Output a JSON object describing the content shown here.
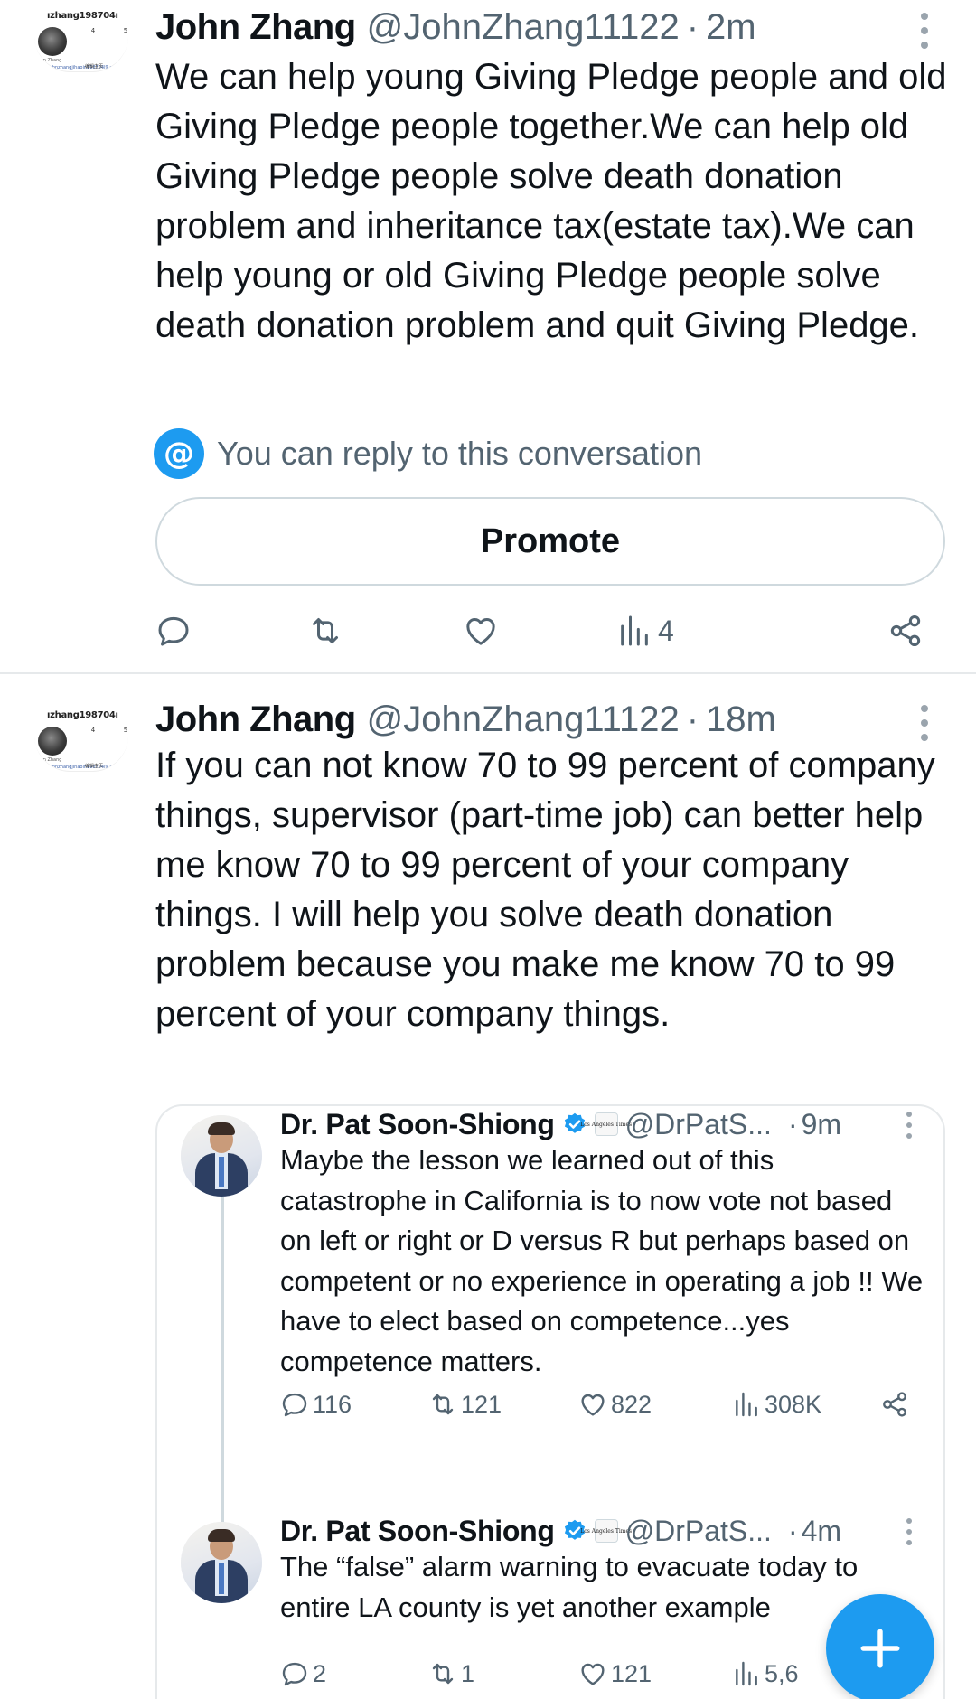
{
  "tweets": [
    {
      "avatar_card": {
        "name": "ızhang198704ı",
        "stat1": "4",
        "stat2": "5",
        "sub": "John Zhang",
        "link": "www.johnzhangjihaoin198704l9.cr",
        "button": "编辑主页"
      },
      "author_name": "John Zhang",
      "handle": "@JohnZhang11122",
      "dot": "·",
      "time": "2m",
      "text": "We can help young Giving Pledge people and old Giving Pledge people together.We can help old Giving Pledge people solve death donation problem and inheritance tax(estate tax).We can help young or old Giving Pledge people solve death donation problem and quit Giving Pledge.",
      "reply_note": "You can reply to this conversation",
      "reply_icon": "@",
      "promote_label": "Promote",
      "views": "4"
    },
    {
      "avatar_card": {
        "name": "ızhang198704ı",
        "stat1": "4",
        "stat2": "5",
        "sub": "John Zhang",
        "link": "www.johnzhangjihaoin198704l9.cr",
        "button": "编辑主页"
      },
      "author_name": "John Zhang",
      "handle": "@JohnZhang11122",
      "dot": "·",
      "time": "18m",
      "text": "If you can not know 70 to 99 percent of company things, supervisor (part-time job) can better help me know 70 to 99 percent of your company things. I will help you solve death donation problem because you make me know 70 to 99 percent of your company things."
    }
  ],
  "quoted": [
    {
      "author_name": "Dr. Pat Soon-Shiong",
      "affiliation_badge": "Los Angeles Times",
      "handle": "@DrPatS...",
      "dot": "·",
      "time": "9m",
      "text": "Maybe the lesson we learned out of this catastrophe in California is to now vote not based on left or right or D versus R but perhaps based on competent or no experience in operating a job !!  We have to elect based on competence...yes competence matters.",
      "replies": "116",
      "reposts": "121",
      "likes": "822",
      "views": "308K"
    },
    {
      "author_name": "Dr. Pat Soon-Shiong",
      "affiliation_badge": "Los Angeles Times",
      "handle": "@DrPatS...",
      "dot": "·",
      "time": "4m",
      "text": "The “false” alarm warning to evacuate today to entire LA county is yet another example",
      "replies": "2",
      "reposts": "1",
      "likes": "121",
      "views": "5,6"
    }
  ],
  "colors": {
    "accent": "#1d9bf0",
    "secondary_text": "#536471",
    "border": "#cfd9de"
  },
  "icons": [
    "reply-icon",
    "repost-icon",
    "like-icon",
    "views-icon",
    "share-icon",
    "verified-icon",
    "more-icon",
    "compose-plus-icon"
  ]
}
